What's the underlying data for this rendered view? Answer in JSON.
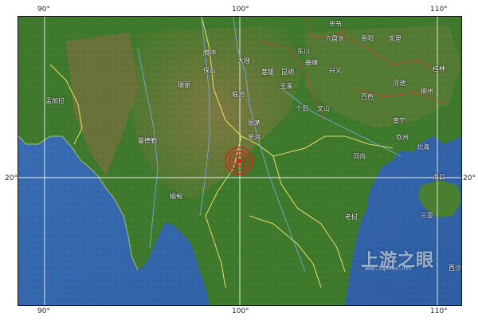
{
  "map": {
    "graticule": {
      "lon_labels_top": [
        "90°",
        "100°",
        "110°"
      ],
      "lon_labels_bottom": [
        "90°",
        "100°",
        "110°"
      ],
      "lat_labels_left": [
        "20°"
      ],
      "lat_labels_right": [
        "20°"
      ]
    },
    "places": [
      {
        "id": "bijie",
        "text": "毕节"
      },
      {
        "id": "liupanshui",
        "text": "六盘水"
      },
      {
        "id": "guiyang",
        "text": "贵阳"
      },
      {
        "id": "kaili",
        "text": "凯里"
      },
      {
        "id": "dongchuan",
        "text": "东川"
      },
      {
        "id": "dali",
        "text": "大理"
      },
      {
        "id": "chuxiong",
        "text": "楚雄"
      },
      {
        "id": "kunming",
        "text": "昆明"
      },
      {
        "id": "qujing",
        "text": "曲靖"
      },
      {
        "id": "xingyi",
        "text": "兴义"
      },
      {
        "id": "baoshan",
        "text": "保山"
      },
      {
        "id": "yuxi",
        "text": "玉溪"
      },
      {
        "id": "lincang",
        "text": "临沧"
      },
      {
        "id": "gejiu",
        "text": "个旧"
      },
      {
        "id": "wenshan",
        "text": "文山"
      },
      {
        "id": "baise",
        "text": "百色"
      },
      {
        "id": "nanning",
        "text": "南宁"
      },
      {
        "id": "hechi",
        "text": "河池"
      },
      {
        "id": "liuzhou",
        "text": "柳州"
      },
      {
        "id": "guilin",
        "text": "桂林"
      },
      {
        "id": "simao",
        "text": "思茅"
      },
      {
        "id": "jinghong",
        "text": "景洪"
      },
      {
        "id": "ruili",
        "text": "瑞丽"
      },
      {
        "id": "tengchong",
        "text": "腾冲"
      },
      {
        "id": "beihai",
        "text": "北海"
      },
      {
        "id": "qinzhou",
        "text": "钦州"
      },
      {
        "id": "haikou",
        "text": "海口"
      },
      {
        "id": "sanya",
        "text": "三亚"
      },
      {
        "id": "xisha",
        "text": "西沙"
      },
      {
        "id": "hanoi",
        "text": "河内"
      },
      {
        "id": "mandalay",
        "text": "曼德勒"
      },
      {
        "id": "myanmar",
        "text": "缅甸"
      },
      {
        "id": "laos",
        "text": "老挝"
      },
      {
        "id": "bangladesh",
        "text": "孟加拉"
      }
    ],
    "epicenter_label": "",
    "watermark": {
      "text": "上游之眼",
      "sub": "www.cqnews.net"
    }
  },
  "colors": {
    "sea": "#3b6fb3",
    "land_green": "#3d7a2c",
    "land_brown": "#8a7a45",
    "graticule": "#ffffff",
    "border_yellow": "#f2e36b",
    "province_red": "#d83a3a",
    "epicenter": "#e02020"
  }
}
